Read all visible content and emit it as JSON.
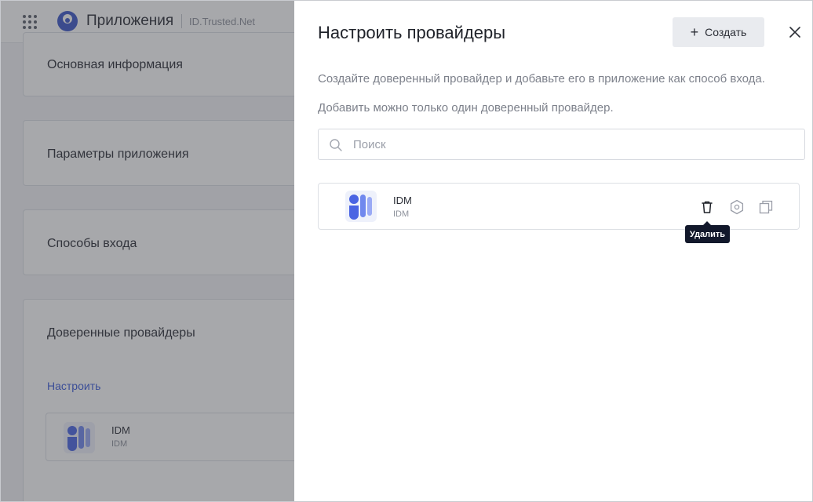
{
  "header": {
    "app_title": "Приложения",
    "app_subtitle": "ID.Trusted.Net"
  },
  "background": {
    "cards": [
      {
        "title": "Основная информация"
      },
      {
        "title": "Параметры приложения"
      },
      {
        "title": "Способы входа"
      },
      {
        "title": "Доверенные провайдеры",
        "link": "Настроить"
      }
    ],
    "provider": {
      "name": "IDM",
      "subtitle": "IDM"
    }
  },
  "drawer": {
    "title": "Настроить провайдеры",
    "create_label": "Создать",
    "description_1": "Создайте доверенный провайдер и добавьте его в приложение как способ входа.",
    "description_2": "Добавить можно только один доверенный провайдер.",
    "search": {
      "placeholder": "Поиск",
      "value": ""
    },
    "providers": [
      {
        "name": "IDM",
        "subtitle": "IDM"
      }
    ],
    "tooltip": "Удалить"
  },
  "icons": {
    "menu": "apps-grid-icon",
    "logo": "app-logo-icon",
    "provider_logo": "idm-logo-icon",
    "close": "close-icon",
    "search": "search-icon",
    "delete": "trash-icon",
    "settings": "settings-icon",
    "copy": "copy-icon"
  },
  "colors": {
    "accent": "#3b5bdb",
    "logo_blue": "#4a64e3",
    "logo_light": "#9aaaf5",
    "tooltip_bg": "#12182b"
  }
}
